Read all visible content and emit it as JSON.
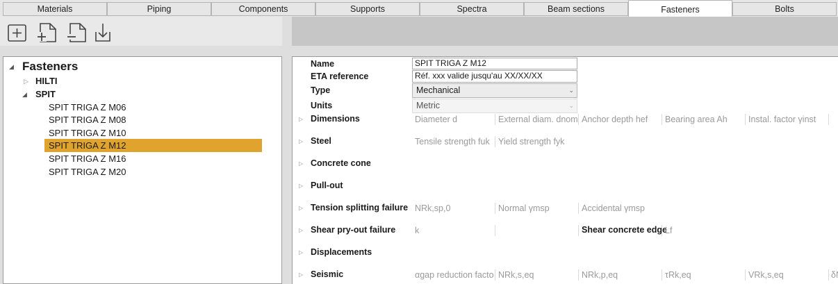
{
  "tabs": [
    {
      "label": "Materials",
      "active": false
    },
    {
      "label": "Piping",
      "active": false
    },
    {
      "label": "Components",
      "active": false
    },
    {
      "label": "Supports",
      "active": false
    },
    {
      "label": "Spectra",
      "active": false
    },
    {
      "label": "Beam sections",
      "active": false
    },
    {
      "label": "Fasteners",
      "active": true
    },
    {
      "label": "Bolts",
      "active": false
    }
  ],
  "toolbar": {
    "icons": [
      "add-new-icon",
      "add-child-icon",
      "remove-icon",
      "import-icon"
    ]
  },
  "tree": {
    "root": "Fasteners",
    "groups": [
      {
        "label": "HILTI",
        "expanded": false,
        "items": []
      },
      {
        "label": "SPIT",
        "expanded": true,
        "items": [
          "SPIT TRIGA Z M06",
          "SPIT TRIGA Z M08",
          "SPIT TRIGA Z M10",
          "SPIT TRIGA Z M12",
          "SPIT TRIGA Z M16",
          "SPIT TRIGA Z M20"
        ]
      }
    ],
    "selected": "SPIT TRIGA Z M12",
    "selected_color": "#e0a42e"
  },
  "properties": {
    "name": {
      "label": "Name",
      "value": "SPIT TRIGA Z M12"
    },
    "eta": {
      "label": "ETA reference",
      "value": "Réf. xxx valide jusqu'au XX/XX/XX"
    },
    "type": {
      "label": "Type",
      "value": "Mechanical"
    },
    "units": {
      "label": "Units",
      "value": "Metric"
    }
  },
  "sections": [
    {
      "label": "Dimensions",
      "cells": [
        "Diameter d",
        "External diam. dnom",
        "Anchor depth hef",
        "Bearing area Ah",
        "Instal. factor γinst"
      ]
    },
    {
      "label": "Steel",
      "cells": [
        "Tensile strength fuk",
        "Yield strength fyk"
      ]
    },
    {
      "label": "Concrete cone",
      "cells": []
    },
    {
      "label": "Pull-out",
      "cells": []
    },
    {
      "label": "Tension splitting failure",
      "cells": [
        "NRk,sp,0",
        "Normal γmsp",
        "Accidental γmsp"
      ]
    },
    {
      "label": "Shear pry-out failure",
      "cells": [
        "k",
        ""
      ],
      "extra_label": "Shear concrete edge",
      "extra_cell": "Lf"
    },
    {
      "label": "Displacements",
      "cells": []
    },
    {
      "label": "Seismic",
      "cells": [
        "αgap reduction factor",
        "NRk,s,eq",
        "NRk,p,eq",
        "τRk,eq",
        "VRk,s,eq",
        "δN"
      ]
    }
  ]
}
